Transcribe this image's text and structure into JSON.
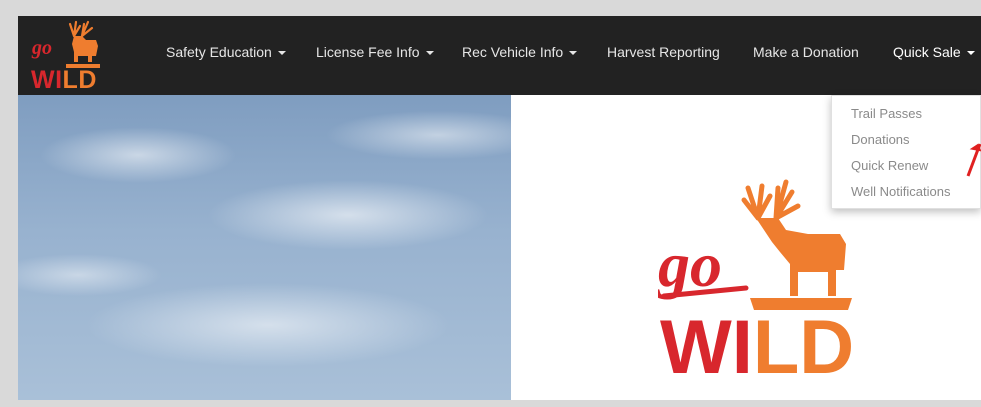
{
  "brand": {
    "logo_top": "go",
    "logo_bottom": "WILD",
    "logo_icon": "deer-icon"
  },
  "nav": {
    "items": [
      {
        "label": "Safety Education",
        "has_caret": true
      },
      {
        "label": "License Fee Info",
        "has_caret": true
      },
      {
        "label": "Rec Vehicle Info",
        "has_caret": true
      },
      {
        "label": "Harvest Reporting",
        "has_caret": false
      },
      {
        "label": "Make a Donation",
        "has_caret": false
      },
      {
        "label": "Quick Sale",
        "has_caret": true,
        "active": true
      }
    ]
  },
  "dropdown": {
    "items": [
      {
        "label": "Trail Passes"
      },
      {
        "label": "Donations"
      },
      {
        "label": "Quick Renew"
      },
      {
        "label": "Well Notifications"
      }
    ]
  },
  "colors": {
    "navbar_bg": "#222222",
    "brand_red": "#d8272d",
    "brand_orange": "#ef7d2f",
    "annotation_red": "#e02020"
  }
}
